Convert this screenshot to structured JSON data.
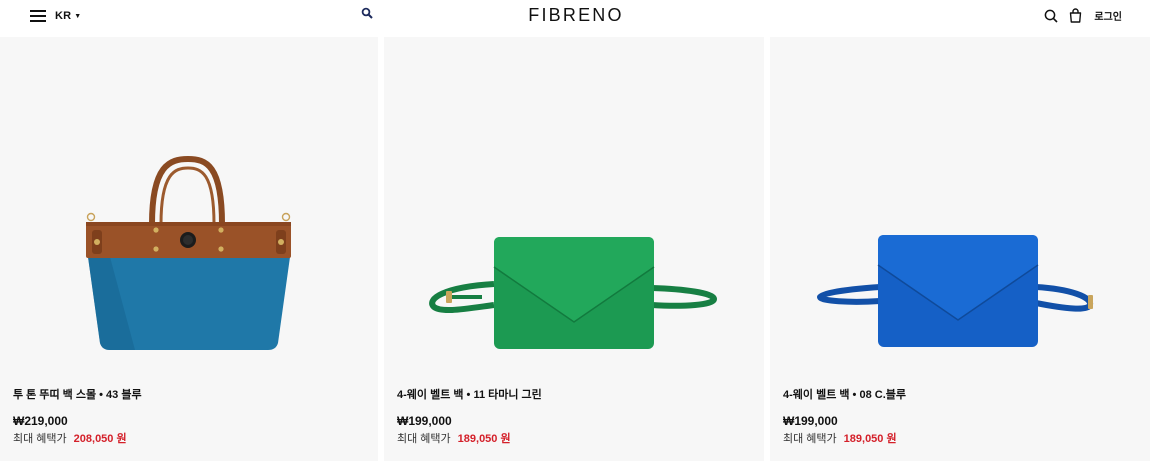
{
  "header": {
    "region": "KR",
    "logo": "FIBRENO",
    "login": "로그인"
  },
  "products": [
    {
      "title": "투 톤 뚜띠 백 스몰 • 43 블루",
      "price": "₩219,000",
      "benefit_label": "최대 혜택가",
      "benefit_price": "208,050 원",
      "colors": {
        "body": "#1f78a8",
        "trim": "#9a5228"
      }
    },
    {
      "title": "4-웨이 벨트 백 • 11 타마니 그린",
      "price": "₩199,000",
      "benefit_label": "최대 혜택가",
      "benefit_price": "189,050 원",
      "colors": {
        "body": "#1c9a52"
      }
    },
    {
      "title": "4-웨이 벨트 백 • 08 C.블루",
      "price": "₩199,000",
      "benefit_label": "최대 혜택가",
      "benefit_price": "189,050 원",
      "colors": {
        "body": "#1560c6"
      }
    }
  ],
  "colors": {
    "accent_sale": "#d4202a",
    "card_bg": "#f7f7f7"
  },
  "icons": [
    "menu-icon",
    "caret-down-icon",
    "search-icon",
    "bag-icon"
  ]
}
